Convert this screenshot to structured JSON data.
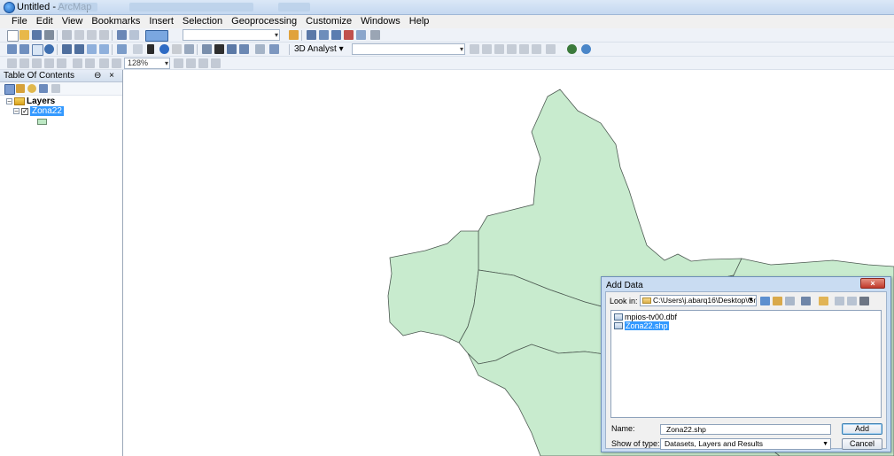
{
  "window": {
    "title": "Untitled - ArcMap"
  },
  "menu": [
    "File",
    "Edit",
    "View",
    "Bookmarks",
    "Insert",
    "Selection",
    "Geoprocessing",
    "Customize",
    "Windows",
    "Help"
  ],
  "toolbars": {
    "scale_value": "",
    "analyst_label": "3D Analyst ▾",
    "analyst_layer_value": "",
    "zoom_value": "128%"
  },
  "toc": {
    "title": "Table Of Contents",
    "header_buttons": "⊖ ×",
    "root_label": "Layers",
    "layer_name": "Zona22",
    "layer_checked": true
  },
  "map": {
    "polygon_fill": "#c8ebce",
    "polygon_stroke": "#4d5a52"
  },
  "dialog": {
    "title": "Add Data",
    "close_label": "×",
    "look_in_label": "Look in:",
    "look_in_value": "C:\\Users\\j.abarq16\\Desktop\\Gn",
    "files": [
      {
        "name": "mpios-tv00.dbf",
        "selected": false
      },
      {
        "name": "Zona22.shp",
        "selected": true
      }
    ],
    "name_label": "Name:",
    "name_value": "Zona22.shp",
    "type_label": "Show of type:",
    "type_value": "Datasets, Layers and Results",
    "add_label": "Add",
    "cancel_label": "Cancel"
  },
  "colors": {
    "accent": "#3399ff",
    "toolbar_bg": "#eef2f8",
    "legend_fill": "#bde8c4"
  }
}
